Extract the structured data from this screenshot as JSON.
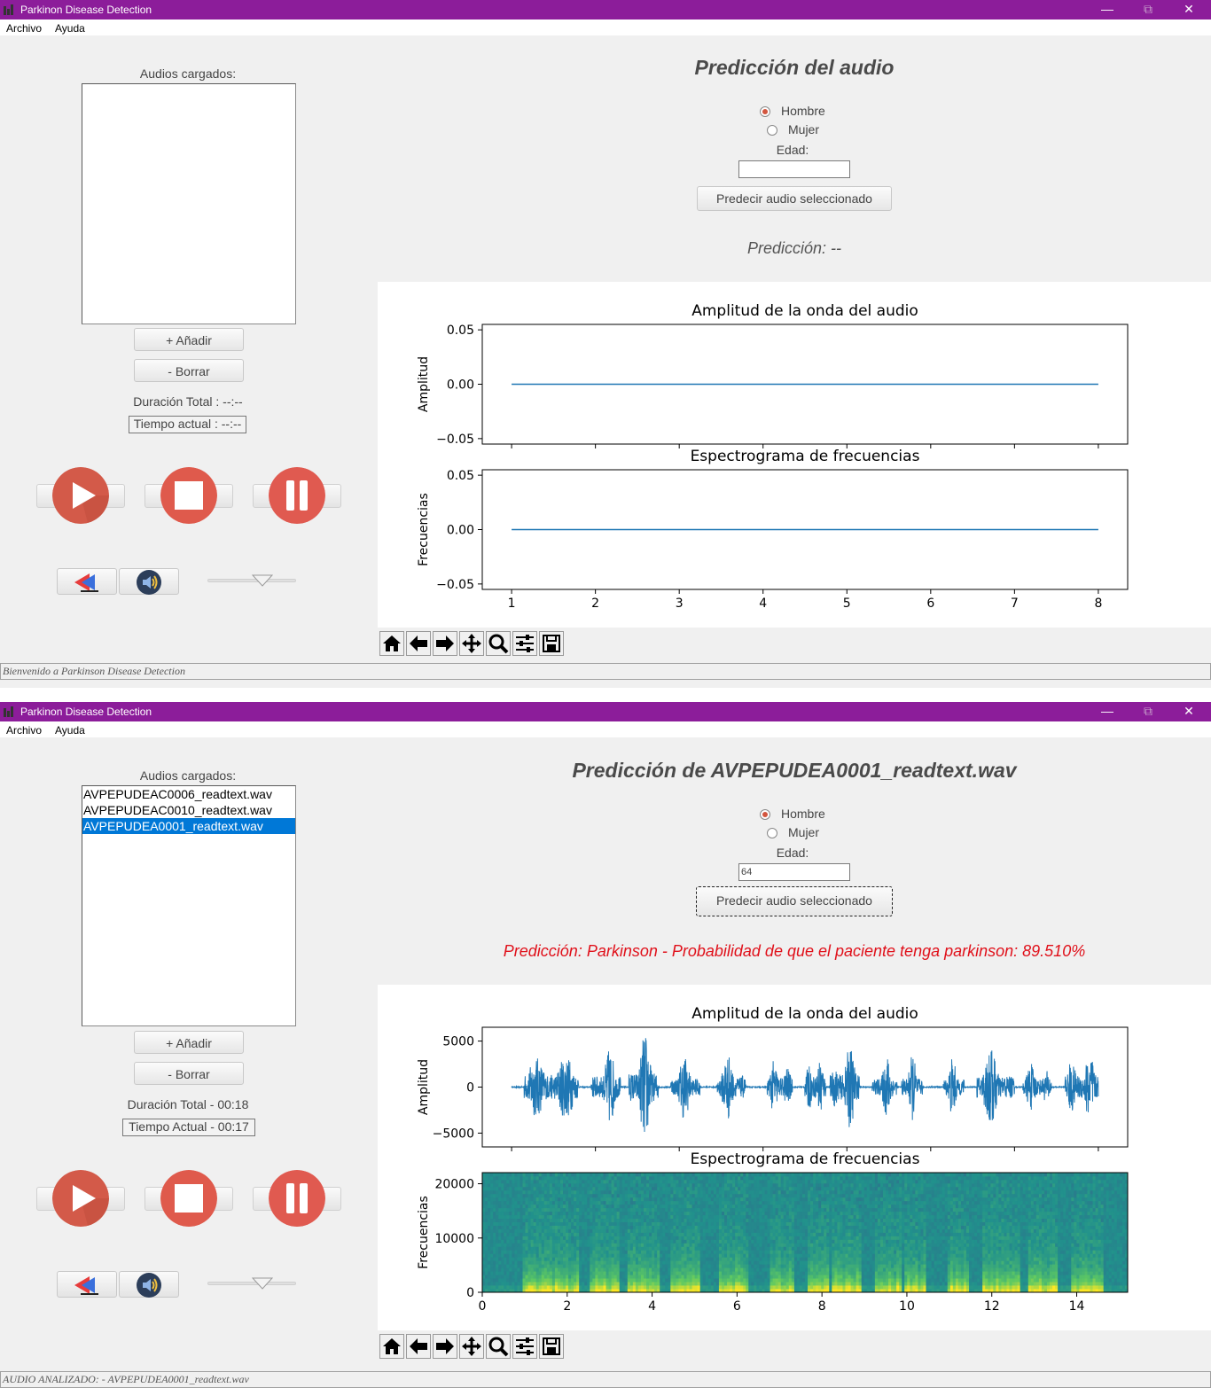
{
  "colors": {
    "titlebar": "#8c1d9a",
    "accent_red": "#e0564a",
    "selection": "#0078d7",
    "line": "#1f77b4",
    "prediction_red": "#e0101a"
  },
  "icons": {
    "play": "play-icon",
    "stop": "stop-icon",
    "pause": "pause-icon",
    "back": "rewind-icon",
    "volume": "speaker-icon",
    "toolbar": [
      "home-icon",
      "back-arrow-icon",
      "forward-arrow-icon",
      "pan-icon",
      "zoom-icon",
      "configure-icon",
      "save-icon"
    ]
  },
  "windows": [
    {
      "title": "Parkinon Disease Detection",
      "menu": [
        "Archivo",
        "Ayuda"
      ],
      "list_label": "Audios cargados:",
      "files": [],
      "add_label": "+ Añadir",
      "delete_label": "- Borrar",
      "duration": "Duración Total : --:--",
      "current_time": "Tiempo actual : --:--",
      "header": "Predicción del audio",
      "radio_male": "Hombre",
      "radio_female": "Mujer",
      "selected_gender": "Hombre",
      "age_label": "Edad:",
      "age_value": "",
      "predict_button": "Predecir audio seleccionado",
      "prediction": "Predicción: --",
      "status": "Bienvenido a Parkinson Disease Detection",
      "chart_data": [
        {
          "type": "line",
          "title": "Amplitud de la onda del audio",
          "ylabel": "Amplitud",
          "xlabel": "",
          "x": [
            1,
            2,
            3,
            4,
            5,
            6,
            7,
            8
          ],
          "y": [
            0,
            0,
            0,
            0,
            0,
            0,
            0,
            0
          ],
          "xlim": [
            0.65,
            8.35
          ],
          "ylim": [
            -0.055,
            0.055
          ],
          "yticks": [
            "0.05",
            "0.00",
            "−0.05"
          ],
          "xticks": [],
          "grid": false
        },
        {
          "type": "line",
          "title": "Espectrograma de frecuencias",
          "ylabel": "Frecuencias",
          "xlabel": "",
          "x": [
            1,
            2,
            3,
            4,
            5,
            6,
            7,
            8
          ],
          "y": [
            0,
            0,
            0,
            0,
            0,
            0,
            0,
            0
          ],
          "xlim": [
            0.65,
            8.35
          ],
          "ylim": [
            -0.055,
            0.055
          ],
          "yticks": [
            "0.05",
            "0.00",
            "−0.05"
          ],
          "xticks": [
            "1",
            "2",
            "3",
            "4",
            "5",
            "6",
            "7",
            "8"
          ],
          "grid": false
        }
      ]
    },
    {
      "title": "Parkinon Disease Detection",
      "menu": [
        "Archivo",
        "Ayuda"
      ],
      "list_label": "Audios cargados:",
      "files": [
        "AVPEPUDEAC0006_readtext.wav",
        "AVPEPUDEAC0010_readtext.wav",
        "AVPEPUDEA0001_readtext.wav"
      ],
      "selected_file": "AVPEPUDEA0001_readtext.wav",
      "add_label": "+ Añadir",
      "delete_label": "- Borrar",
      "duration": "Duración Total - 00:18",
      "current_time": "Tiempo Actual  - 00:17",
      "header": "Predicción de AVPEPUDEA0001_readtext.wav",
      "radio_male": "Hombre",
      "radio_female": "Mujer",
      "selected_gender": "Hombre",
      "age_label": "Edad:",
      "age_value": "64",
      "predict_button": "Predecir audio seleccionado",
      "prediction": "Predicción: Parkinson - Probabilidad de que el paciente tenga parkinson: 89.510%",
      "status": "AUDIO ANALIZADO: - AVPEPUDEA0001_readtext.wav",
      "chart_data": [
        {
          "type": "line",
          "title": "Amplitud de la onda del audio",
          "ylabel": "Amplitud",
          "xlabel": "",
          "xlim": [
            -0.7,
            14.7
          ],
          "ylim": [
            -6500,
            6500
          ],
          "yticks": [
            "5000",
            "0",
            "−5000"
          ],
          "xticks": [],
          "grid": false,
          "bursts": [
            [
              0.3,
              1.6,
              5300
            ],
            [
              1.9,
              2.6,
              4600
            ],
            [
              2.8,
              3.5,
              6000
            ],
            [
              3.8,
              4.5,
              3600
            ],
            [
              4.9,
              5.6,
              4100
            ],
            [
              6.1,
              6.7,
              4000
            ],
            [
              7.0,
              7.5,
              4600
            ],
            [
              7.6,
              8.3,
              5400
            ],
            [
              8.6,
              9.2,
              3600
            ],
            [
              9.3,
              9.8,
              3600
            ],
            [
              10.3,
              10.8,
              3400
            ],
            [
              11.1,
              12.0,
              4700
            ],
            [
              12.2,
              12.9,
              3400
            ],
            [
              13.2,
              14.0,
              5000
            ]
          ]
        },
        {
          "type": "heatmap",
          "title": "Espectrograma de frecuencias",
          "ylabel": "Frecuencias",
          "xlabel": "",
          "xlim": [
            0,
            15.2
          ],
          "ylim": [
            0,
            22050
          ],
          "yticks": [
            "20000",
            "10000",
            "0"
          ],
          "xticks": [
            "0",
            "2",
            "4",
            "6",
            "8",
            "10",
            "12",
            "14"
          ],
          "grid": false
        }
      ]
    }
  ]
}
